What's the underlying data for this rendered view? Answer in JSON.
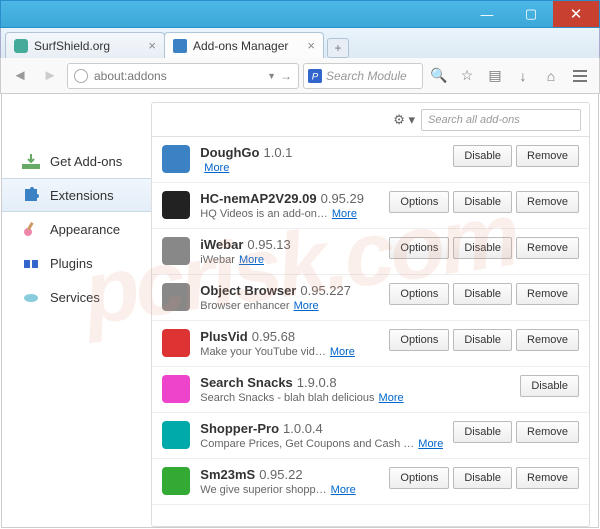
{
  "window": {
    "min": "—",
    "max": "▢",
    "close": "✕"
  },
  "tabs": [
    {
      "label": "SurfShield.org",
      "icon": "#4a9"
    },
    {
      "label": "Add-ons Manager",
      "icon": "#3b82c4"
    }
  ],
  "newtab": "+",
  "url": {
    "value": "about:addons",
    "go": "→"
  },
  "searchbar": {
    "placeholder": "Search Module"
  },
  "toolbar": {
    "search": "🔍",
    "bookmark": "☆",
    "list": "▤",
    "download": "↓",
    "home": "⌂"
  },
  "sidebar": {
    "items": [
      {
        "label": "Get Add-ons"
      },
      {
        "label": "Extensions"
      },
      {
        "label": "Appearance"
      },
      {
        "label": "Plugins"
      },
      {
        "label": "Services"
      }
    ]
  },
  "main": {
    "gear": "⚙ ▾",
    "search_placeholder": "Search all add-ons",
    "more": "More",
    "btn_options": "Options",
    "btn_disable": "Disable",
    "btn_remove": "Remove",
    "addons": [
      {
        "name": "DoughGo",
        "ver": "1.0.1",
        "desc": "",
        "opts": false,
        "disable": true,
        "remove": true,
        "ico": "#3b82c4"
      },
      {
        "name": "HC-nemAP2V29.09",
        "ver": "0.95.29",
        "desc": "HQ Videos is an add-on…",
        "opts": true,
        "disable": true,
        "remove": true,
        "ico": "#222"
      },
      {
        "name": "iWebar",
        "ver": "0.95.13",
        "desc": "iWebar",
        "opts": true,
        "disable": true,
        "remove": true,
        "ico": "#888"
      },
      {
        "name": "Object Browser",
        "ver": "0.95.227",
        "desc": "Browser enhancer",
        "opts": true,
        "disable": true,
        "remove": true,
        "ico": "#888"
      },
      {
        "name": "PlusVid",
        "ver": "0.95.68",
        "desc": "Make your YouTube vid…",
        "opts": true,
        "disable": true,
        "remove": true,
        "ico": "#d33"
      },
      {
        "name": "Search Snacks",
        "ver": "1.9.0.8",
        "desc": "Search Snacks - blah blah delicious",
        "opts": false,
        "disable": true,
        "remove": false,
        "ico": "#e4c"
      },
      {
        "name": "Shopper-Pro",
        "ver": "1.0.0.4",
        "desc": "Compare Prices, Get Coupons and Cash …",
        "opts": false,
        "disable": true,
        "remove": true,
        "ico": "#0aa"
      },
      {
        "name": "Sm23mS",
        "ver": "0.95.22",
        "desc": "We give superior shopp…",
        "opts": true,
        "disable": true,
        "remove": true,
        "ico": "#3a3"
      }
    ]
  },
  "watermark": "pcrisk.com"
}
